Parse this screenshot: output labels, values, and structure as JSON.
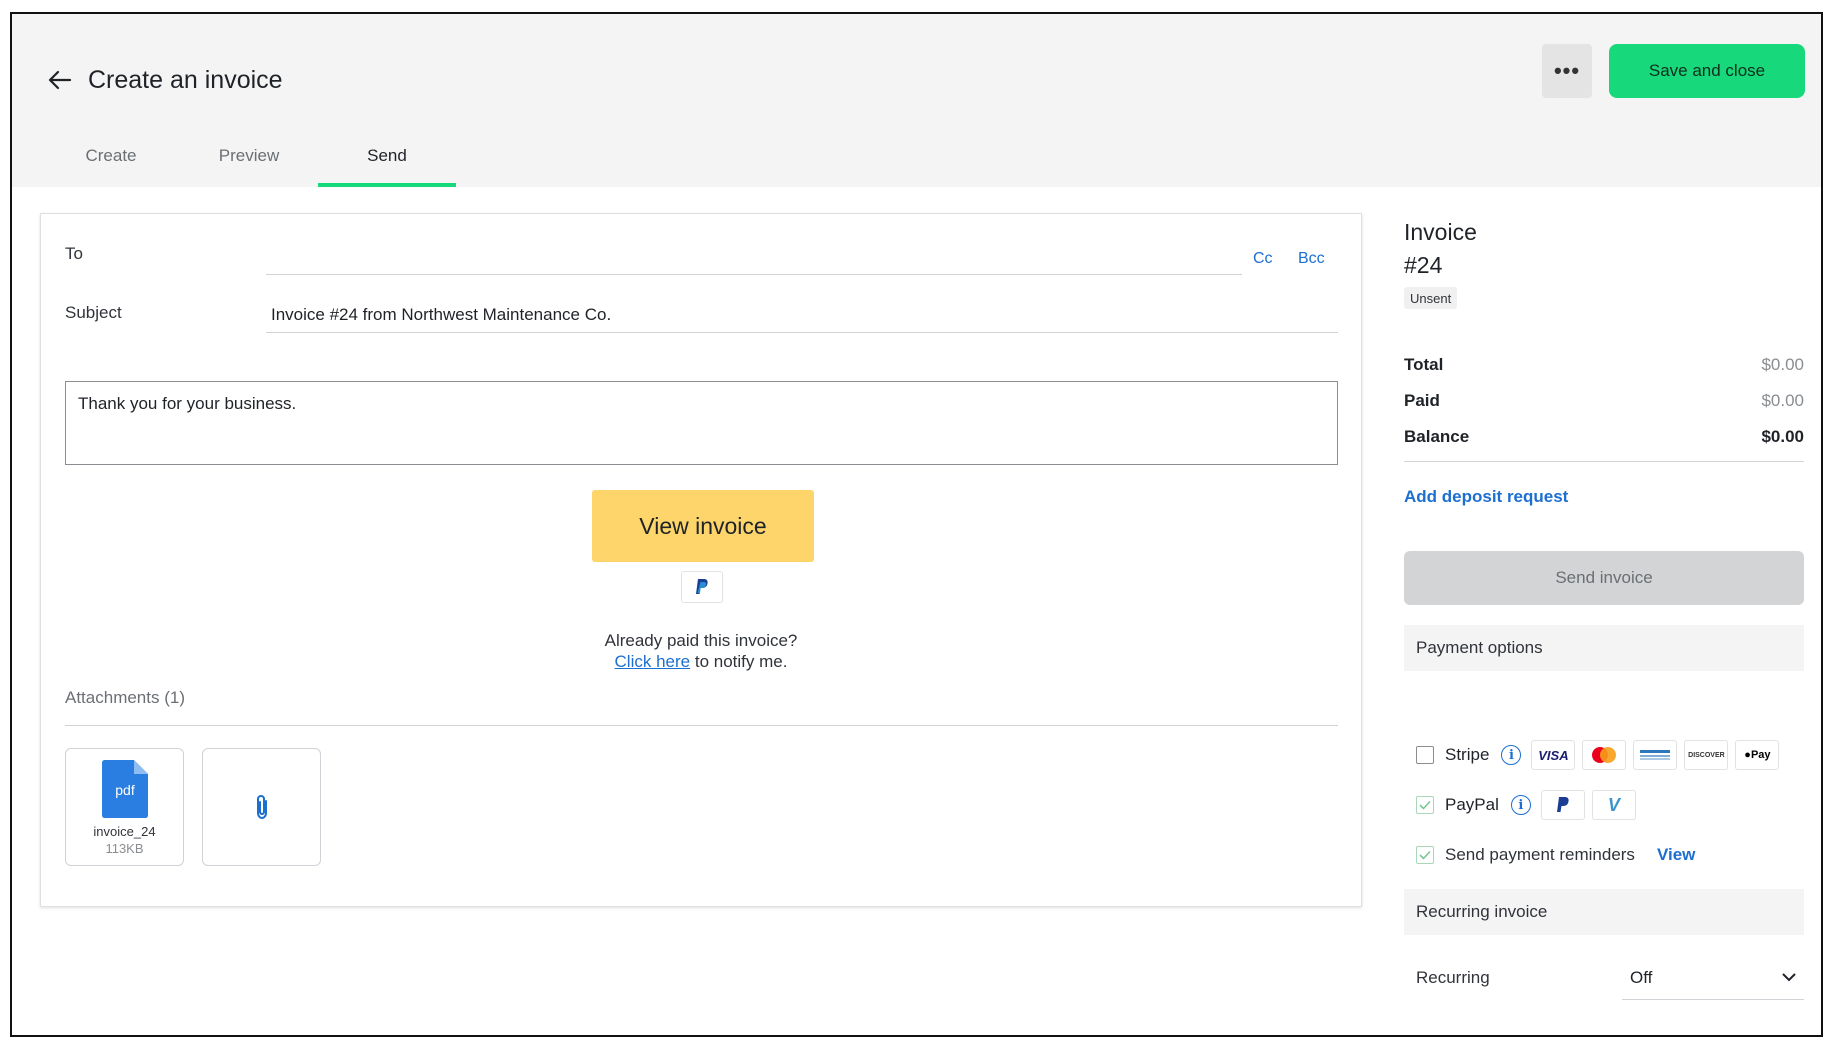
{
  "header": {
    "title": "Create an invoice",
    "more_label": "•••",
    "save_label": "Save and close",
    "tabs": [
      {
        "label": "Create"
      },
      {
        "label": "Preview"
      },
      {
        "label": "Send"
      }
    ]
  },
  "email": {
    "to_label": "To",
    "to_value": "",
    "cc_label": "Cc",
    "bcc_label": "Bcc",
    "subject_label": "Subject",
    "subject_value": "Invoice #24 from Northwest Maintenance Co.",
    "message": "Thank you for your business.",
    "view_invoice_label": "View invoice",
    "already_paid_text": "Already paid this invoice?",
    "click_here_label": "Click here",
    "notify_text": " to notify me."
  },
  "attachments": {
    "label": "Attachments (1)",
    "files": [
      {
        "name": "invoice_24",
        "size": "113KB",
        "type_label": "pdf"
      }
    ]
  },
  "invoice": {
    "title": "Invoice",
    "number": "#24",
    "status": "Unsent",
    "total_label": "Total",
    "total_value": "$0.00",
    "paid_label": "Paid",
    "paid_value": "$0.00",
    "balance_label": "Balance",
    "balance_value": "$0.00",
    "deposit_link": "Add deposit request",
    "send_label": "Send invoice"
  },
  "payment_options": {
    "heading": "Payment options",
    "stripe_label": "Stripe",
    "stripe_checked": false,
    "stripe_cards": [
      "VISA",
      "Mastercard",
      "AMERICAN EXPRESS",
      "DISCOVER",
      "Pay"
    ],
    "paypal_label": "PayPal",
    "paypal_checked": true,
    "reminders_label": "Send payment reminders",
    "reminders_checked": true,
    "reminders_view": "View"
  },
  "recurring": {
    "heading": "Recurring invoice",
    "label": "Recurring",
    "value": "Off"
  },
  "colors": {
    "accent_green": "#17d97b",
    "link_blue": "#1c6fd1",
    "view_invoice_yellow": "#fdd56a"
  }
}
